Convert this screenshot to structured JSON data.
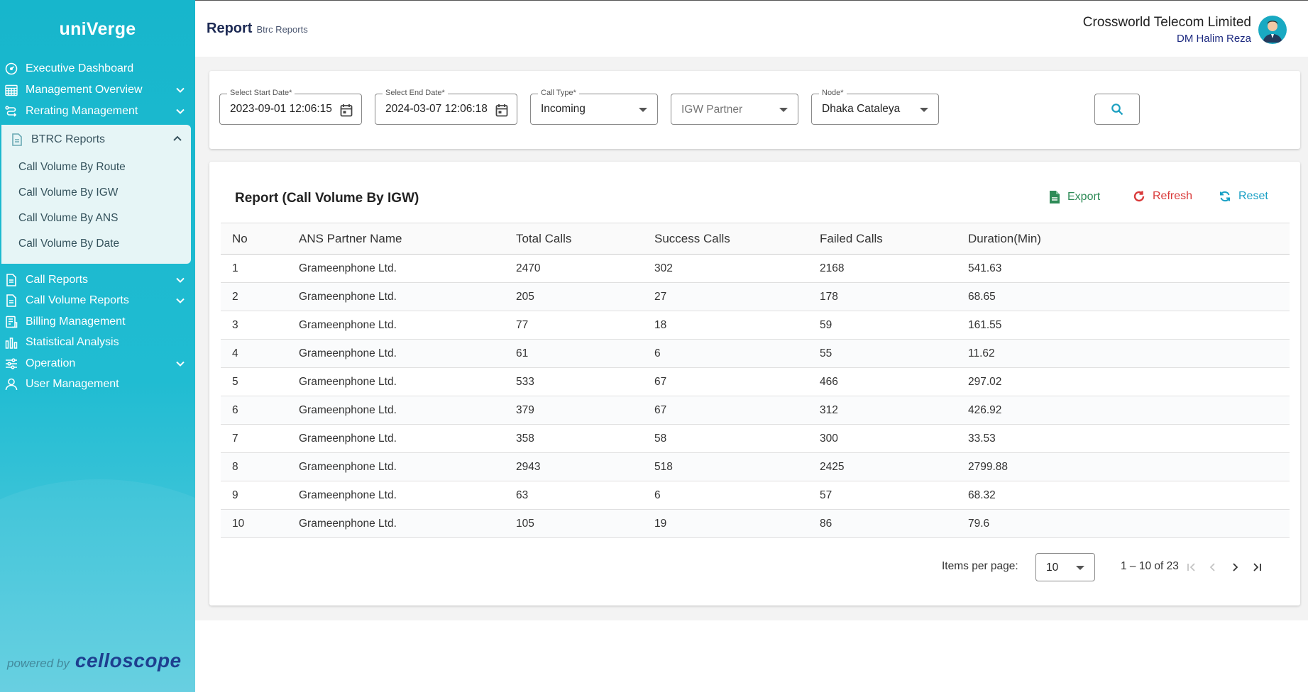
{
  "app": {
    "logo_text": "uniVerge",
    "powered_label": "powered by",
    "powered_brand": "celloscope"
  },
  "sidebar": {
    "items_top": [
      {
        "label": "Executive Dashboard",
        "icon": "gauge-icon",
        "has_chevron": false
      },
      {
        "label": "Management Overview",
        "icon": "calendar-grid-icon",
        "has_chevron": true
      },
      {
        "label": "Rerating Management",
        "icon": "route-icon",
        "has_chevron": true
      }
    ],
    "btrc": {
      "label": "BTRC Reports",
      "icon": "document-icon",
      "expanded": true,
      "children": [
        {
          "label": "Call Volume By Route"
        },
        {
          "label": "Call Volume By IGW"
        },
        {
          "label": "Call Volume By ANS"
        },
        {
          "label": "Call Volume By Date"
        }
      ]
    },
    "items_bottom": [
      {
        "label": "Call Reports",
        "icon": "document-icon",
        "has_chevron": true
      },
      {
        "label": "Call Volume Reports",
        "icon": "document-icon",
        "has_chevron": true
      },
      {
        "label": "Billing Management",
        "icon": "billing-icon",
        "has_chevron": false
      },
      {
        "label": "Statistical Analysis",
        "icon": "bar-chart-icon",
        "has_chevron": false
      },
      {
        "label": "Operation",
        "icon": "sliders-icon",
        "has_chevron": true
      },
      {
        "label": "User Management",
        "icon": "user-icon",
        "has_chevron": false
      }
    ]
  },
  "header": {
    "title": "Report",
    "subtitle": "Btrc Reports",
    "company": "Crossworld Telecom Limited",
    "user": "DM Halim Reza"
  },
  "filters": {
    "start_date": {
      "label": "Select Start Date*",
      "value": "2023-09-01 12:06:15"
    },
    "end_date": {
      "label": "Select End Date*",
      "value": "2024-03-07 12:06:18"
    },
    "call_type": {
      "label": "Call Type*",
      "value": "Incoming"
    },
    "igw_partner": {
      "placeholder": "IGW Partner"
    },
    "node": {
      "label": "Node*",
      "value": "Dhaka Cataleya"
    }
  },
  "report": {
    "title": "Report (Call Volume By IGW)",
    "actions": {
      "export": "Export",
      "refresh": "Refresh",
      "reset": "Reset"
    },
    "columns": [
      "No",
      "ANS Partner Name",
      "Total Calls",
      "Success Calls",
      "Failed Calls",
      "Duration(Min)"
    ],
    "rows": [
      [
        "1",
        "Grameenphone Ltd.",
        "2470",
        "302",
        "2168",
        "541.63"
      ],
      [
        "2",
        "Grameenphone Ltd.",
        "205",
        "27",
        "178",
        "68.65"
      ],
      [
        "3",
        "Grameenphone Ltd.",
        "77",
        "18",
        "59",
        "161.55"
      ],
      [
        "4",
        "Grameenphone Ltd.",
        "61",
        "6",
        "55",
        "11.62"
      ],
      [
        "5",
        "Grameenphone Ltd.",
        "533",
        "67",
        "466",
        "297.02"
      ],
      [
        "6",
        "Grameenphone Ltd.",
        "379",
        "67",
        "312",
        "426.92"
      ],
      [
        "7",
        "Grameenphone Ltd.",
        "358",
        "58",
        "300",
        "33.53"
      ],
      [
        "8",
        "Grameenphone Ltd.",
        "2943",
        "518",
        "2425",
        "2799.88"
      ],
      [
        "9",
        "Grameenphone Ltd.",
        "63",
        "6",
        "57",
        "68.32"
      ],
      [
        "10",
        "Grameenphone Ltd.",
        "105",
        "19",
        "86",
        "79.6"
      ]
    ],
    "pagination": {
      "items_per_page_label": "Items per page:",
      "items_per_page": "10",
      "range": "1 – 10 of 23"
    }
  },
  "colors": {
    "sidebar": "#1fb9cf",
    "export": "#2e8b57",
    "refresh": "#d93a3a",
    "reset": "#1aa0c5"
  }
}
